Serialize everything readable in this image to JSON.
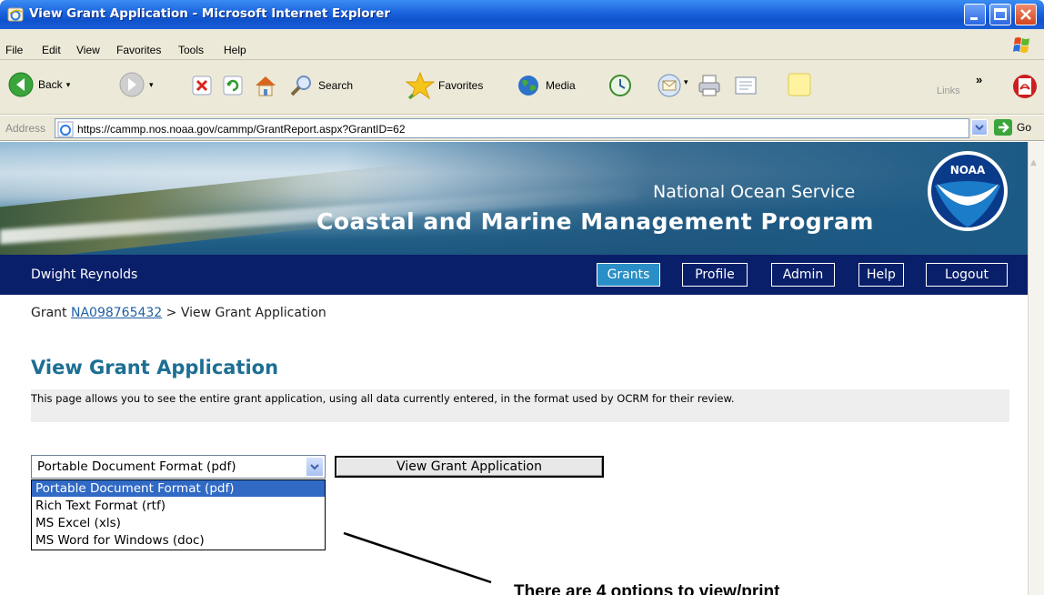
{
  "window": {
    "title": "View Grant Application - Microsoft Internet Explorer"
  },
  "menu": [
    "File",
    "Edit",
    "View",
    "Favorites",
    "Tools",
    "Help"
  ],
  "toolbar": {
    "back_label": "Back",
    "search_label": "Search",
    "favorites_label": "Favorites",
    "media_label": "Media",
    "links_label": "Links"
  },
  "address": {
    "label": "Address",
    "url": "https://cammp.nos.noaa.gov/cammp/GrantReport.aspx?GrantID=62",
    "go_label": "Go"
  },
  "banner": {
    "org": "National Ocean Service",
    "program": "Coastal and Marine Management Program",
    "logo_text": "NOAA"
  },
  "nav": {
    "user": "Dwight Reynolds",
    "buttons": [
      "Grants",
      "Profile",
      "Admin",
      "Help",
      "Logout"
    ],
    "active": "Grants"
  },
  "breadcrumb": {
    "prefix": "Grant",
    "grant_id": "NA098765432",
    "separator": ">",
    "current": "View Grant Application"
  },
  "page": {
    "title": "View Grant Application",
    "description": "This page allows you to see the entire grant application, using all data currently entered, in the format used by OCRM for their review."
  },
  "format_select": {
    "selected": "Portable Document Format (pdf)",
    "options": [
      "Portable Document Format (pdf)",
      "Rich Text Format (rtf)",
      "MS Excel (xls)",
      "MS Word for Windows (doc)"
    ]
  },
  "view_button_label": "View Grant Application",
  "annotation": "There are 4 options to view/print",
  "colors": {
    "nav_bg": "#0a1f6a",
    "active_tab": "#2a8fc6",
    "title_blue": "#1d6e93",
    "selection": "#316ac5"
  }
}
